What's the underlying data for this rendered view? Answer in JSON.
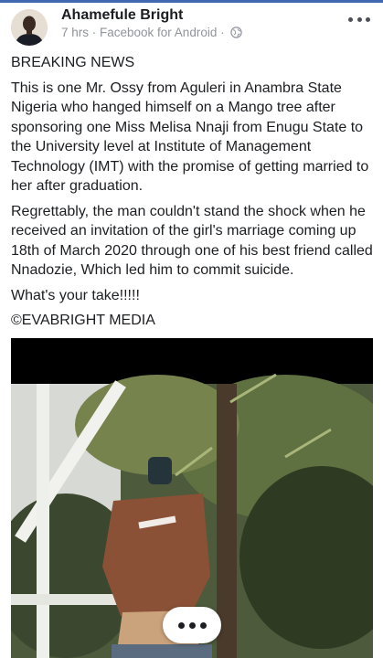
{
  "post": {
    "author": "Ahamefule Bright",
    "meta": "7 hrs · Facebook for Android ·",
    "paragraphs": [
      "BREAKING NEWS",
      "This is one Mr. Ossy from Aguleri in Anambra State Nigeria who hanged himself on a Mango tree after sponsoring one Miss Melisa Nnaji from Enugu State to the University level at Institute of Management Technology (IMT) with the promise of getting married to her after graduation.",
      "Regrettably, the man couldn't stand the shock when he received an invitation of the girl's marriage coming up 18th of March 2020 through one of his best friend called Nnadozie, Which led him to commit suicide.",
      "What's your take!!!!!",
      "©EVABRIGHT MEDIA"
    ]
  },
  "icons": {
    "more": "more-options-icon",
    "privacy": "globe-icon",
    "media_more": "ellipsis-icon"
  }
}
